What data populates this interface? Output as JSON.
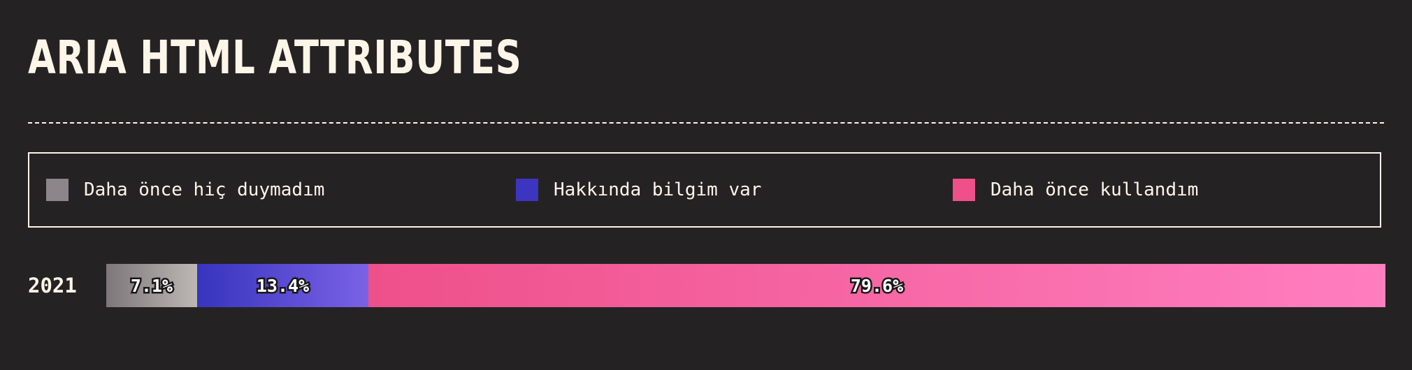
{
  "title": "ARIA HTML ATTRIBUTES",
  "chart_data": {
    "type": "bar",
    "orientation": "horizontal",
    "stacked": true,
    "title": "ARIA HTML ATTRIBUTES",
    "categories": [
      "2021"
    ],
    "series": [
      {
        "name": "Daha önce hiç duymadım",
        "values": [
          7.1
        ],
        "label": "7.1%",
        "color_start": "#7d777b",
        "color_end": "#bdb7b4",
        "legend_color": "#8c868a"
      },
      {
        "name": "Hakkında bilgim var",
        "values": [
          13.4
        ],
        "label": "13.4%",
        "color_start": "#3734bd",
        "color_end": "#7a62e6",
        "legend_color": "#3b35c2"
      },
      {
        "name": "Daha önce kullandım",
        "values": [
          79.6
        ],
        "label": "79.6%",
        "color_start": "#ee508a",
        "color_end": "#ff7ec0",
        "legend_color": "#f0508a"
      }
    ],
    "xlim": [
      0,
      100
    ],
    "legend": "top",
    "grid": false
  }
}
